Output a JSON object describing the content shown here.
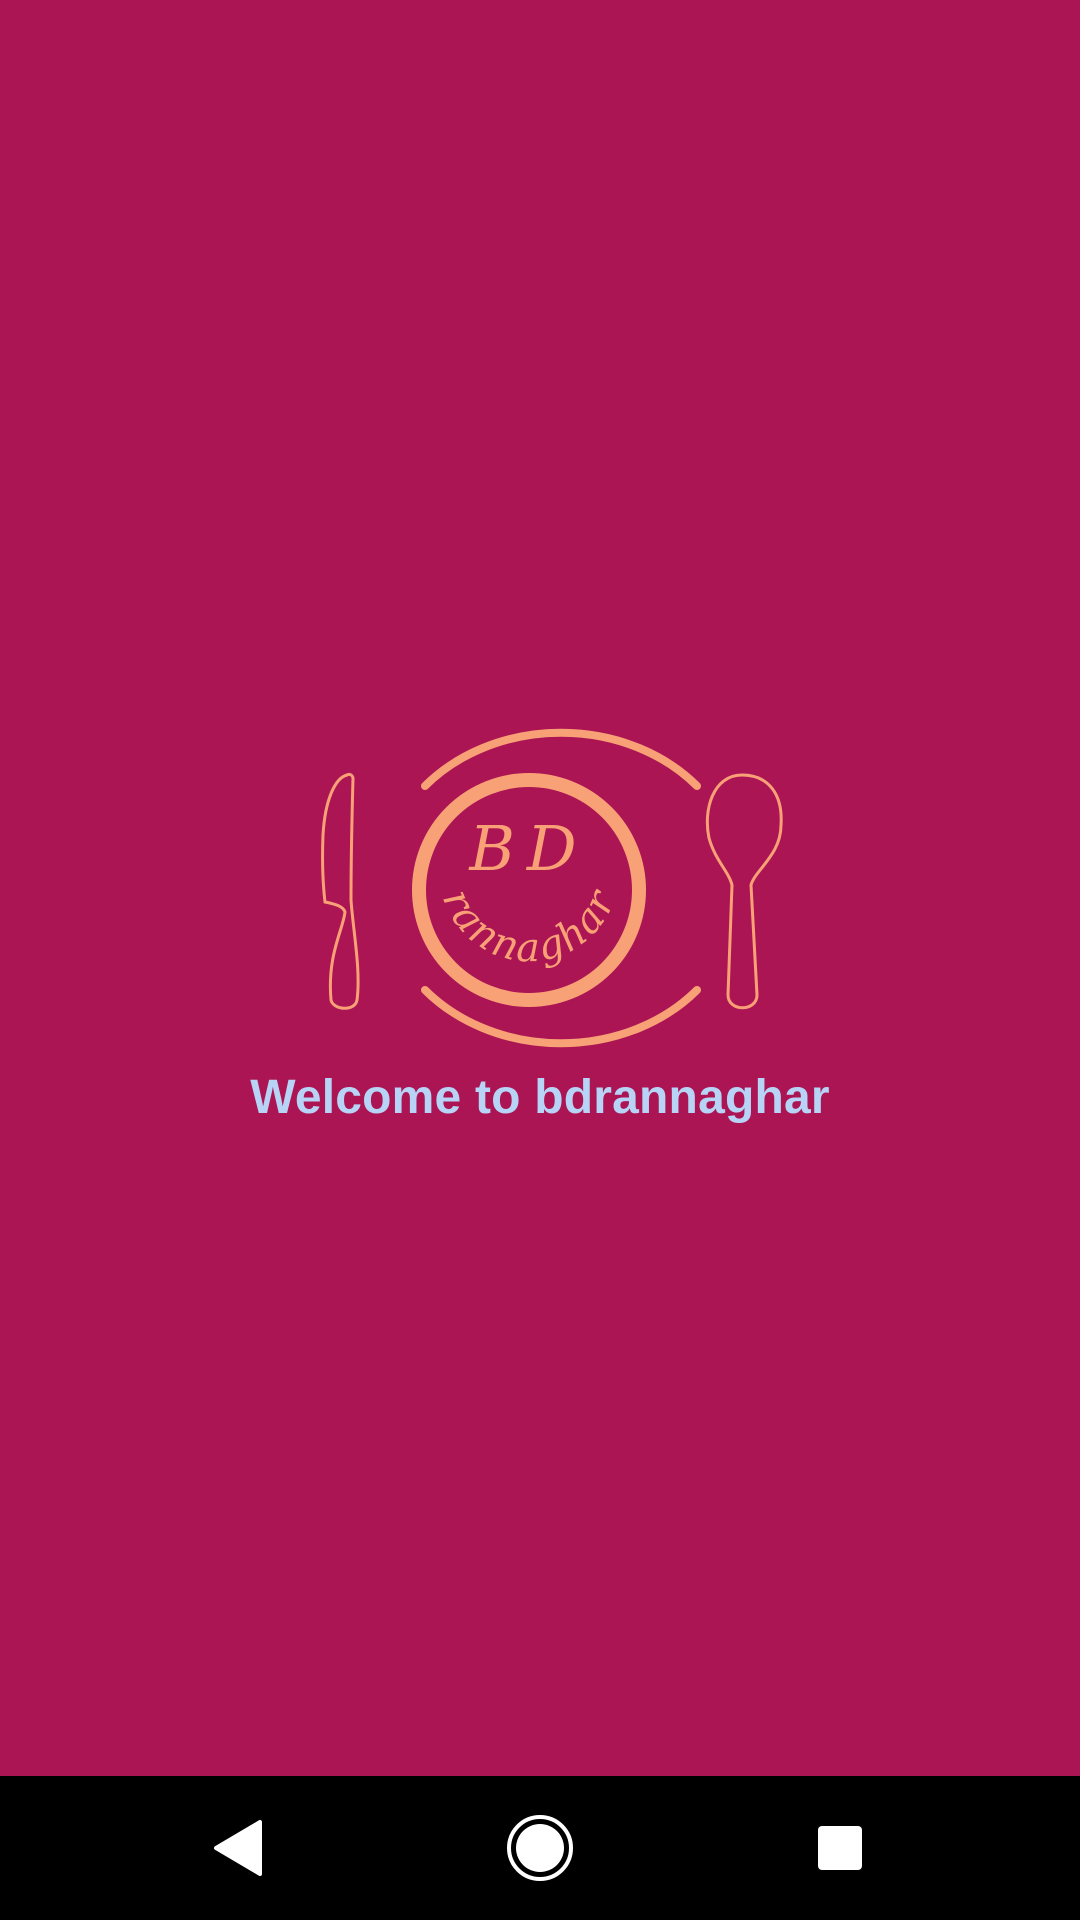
{
  "app": {
    "welcome_text": "Welcome to bdrannaghar",
    "logo_text_top": "BD",
    "logo_text_curved": "rannaghar"
  },
  "colors": {
    "background": "#ac1553",
    "logo": "#f8a177",
    "welcome_text": "#b7d3f5",
    "nav_bar": "#000000",
    "nav_icons": "#ffffff"
  },
  "navbar": {
    "icons": [
      "back-icon",
      "home-icon",
      "recents-icon"
    ]
  }
}
